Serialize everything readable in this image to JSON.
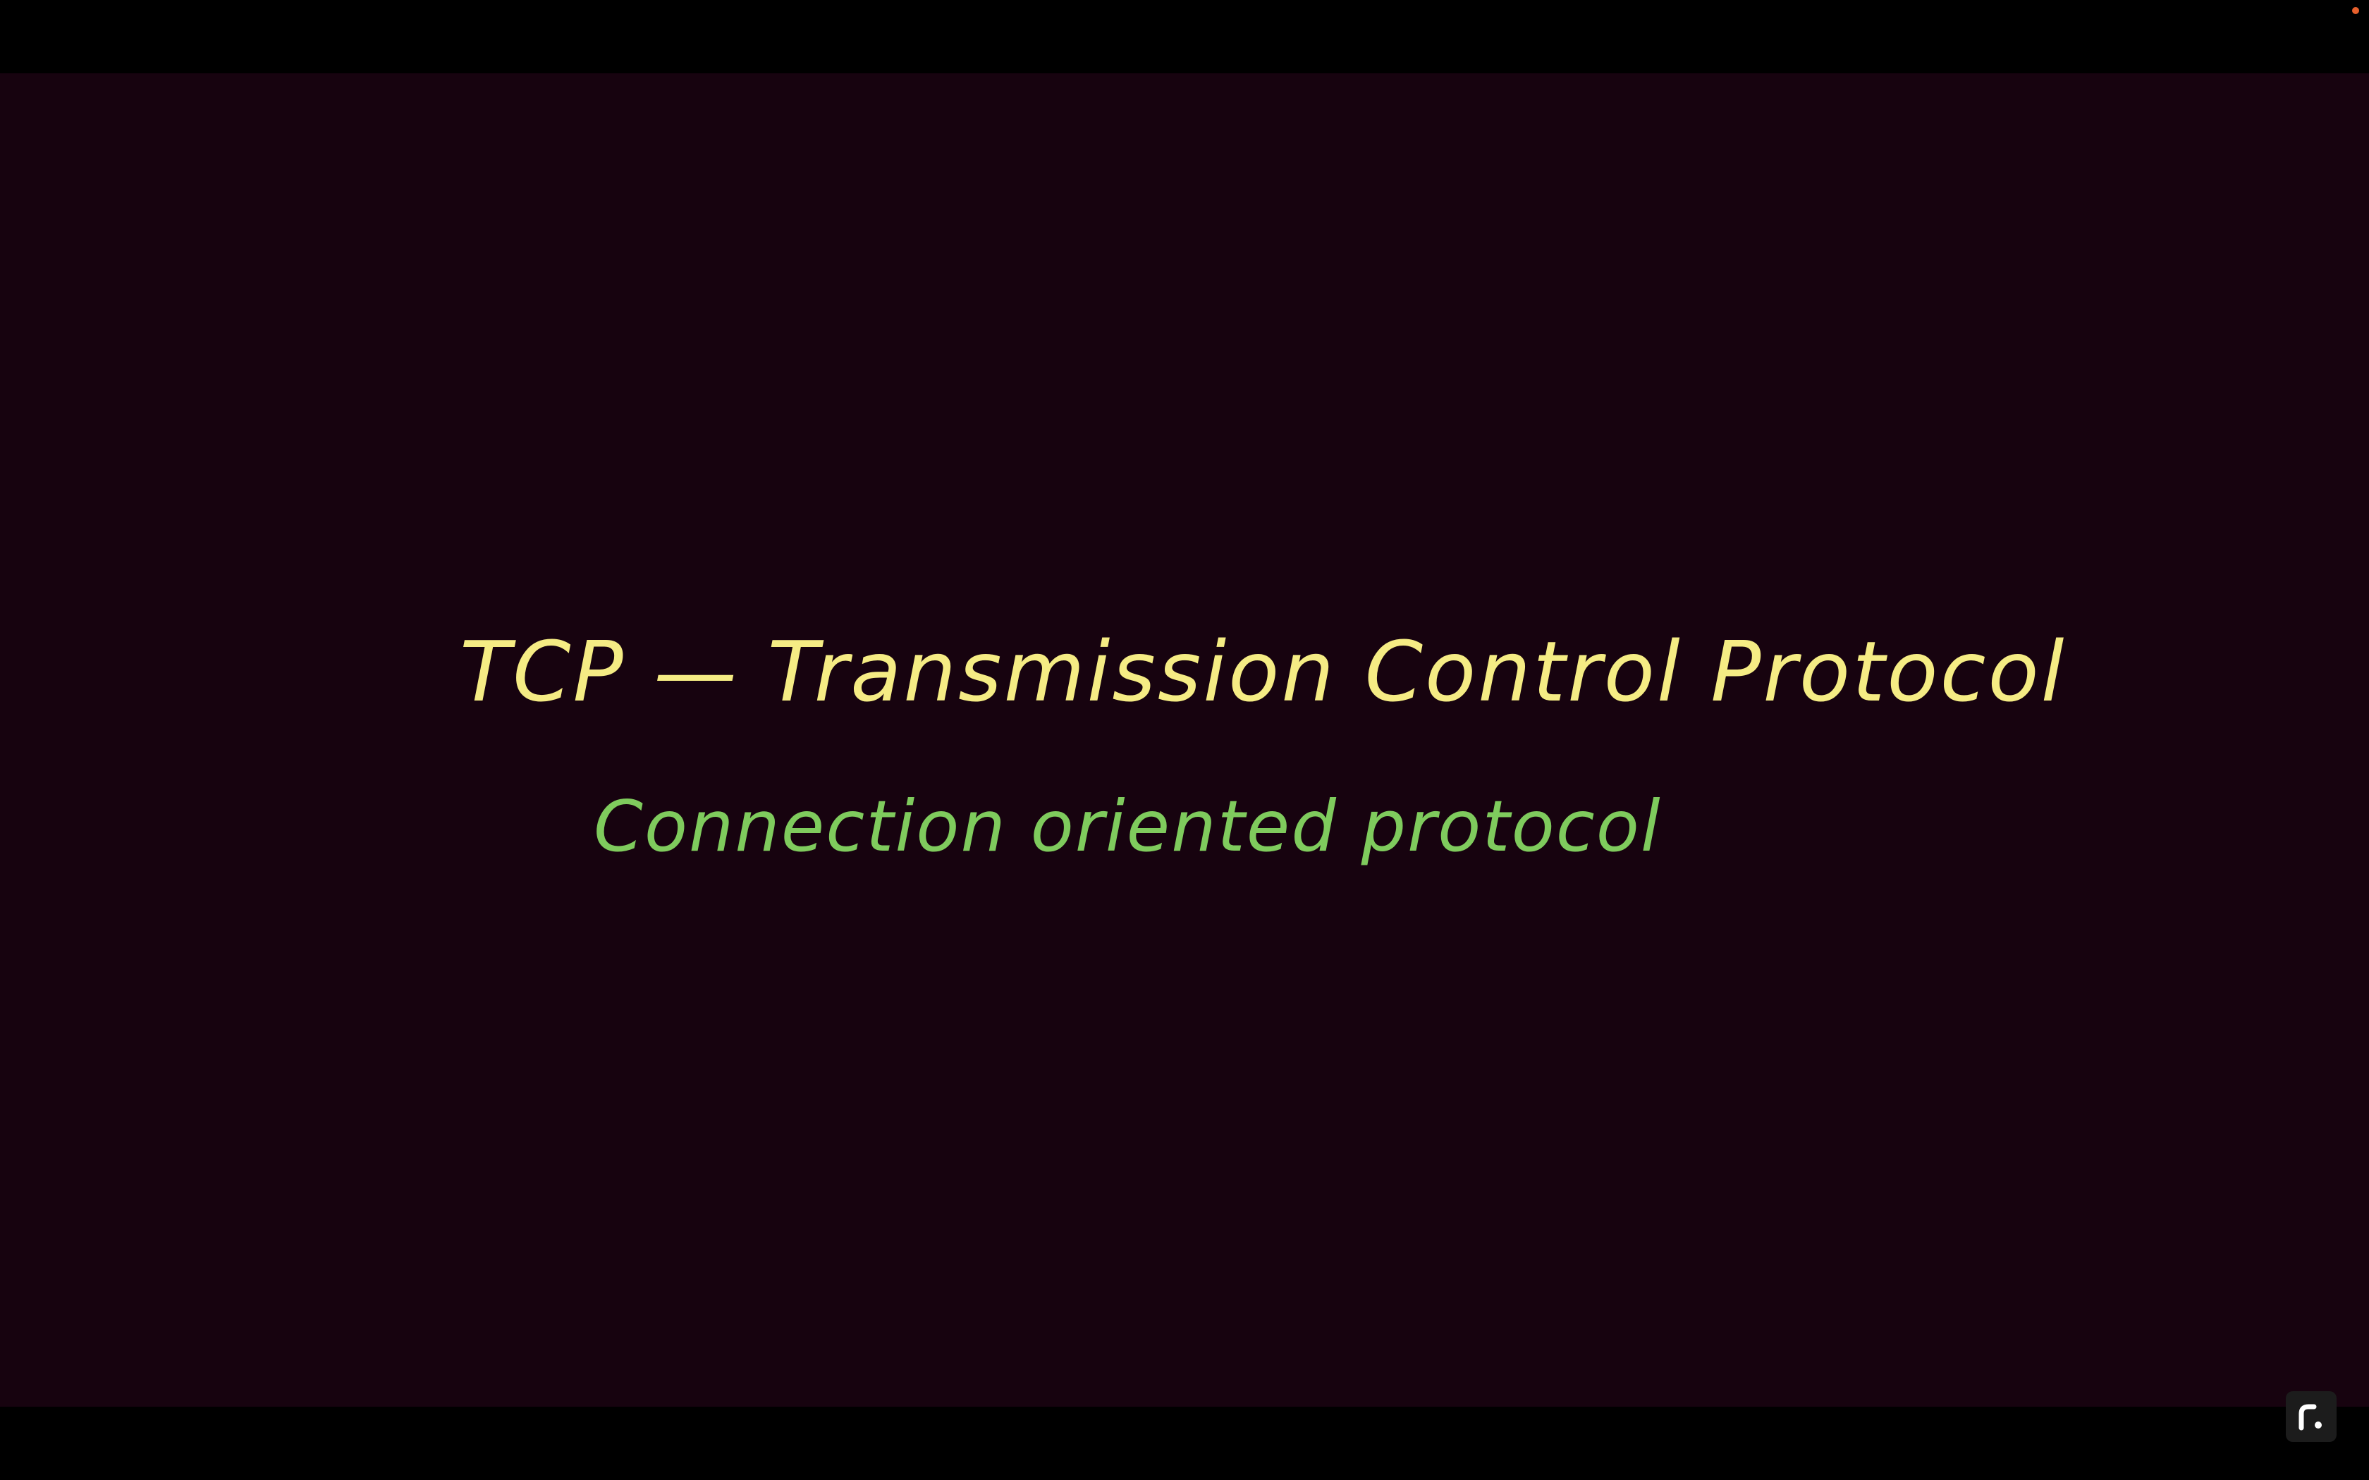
{
  "slide": {
    "title": "TCP — Transmission Control Protocol",
    "subtitle": "Connection oriented protocol"
  },
  "colors": {
    "background": "#17030F",
    "title": "#F5EC84",
    "subtitle": "#7FCB5D",
    "recording_dot": "#E8602C",
    "logo": "#FFFFFF"
  },
  "icons": {
    "recording_indicator": "recording-dot-icon",
    "app_logo": "app-logo-icon"
  }
}
